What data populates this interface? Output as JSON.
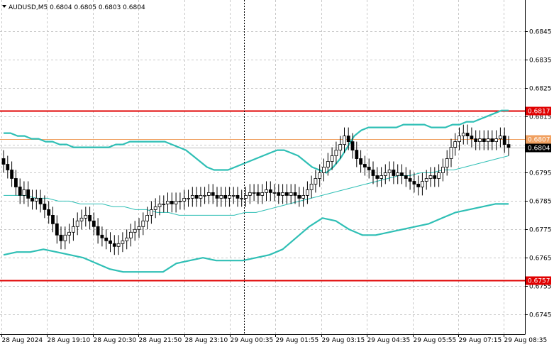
{
  "header": {
    "symbol_info": "AUDUSD,M5 0.6804 0.6805 0.6803 0.6804"
  },
  "colors": {
    "background": "#ffffff",
    "grid": "#c8c8c8",
    "candle": "#000000",
    "bollinger": "#2fbfb5",
    "resistance": "#e00000",
    "support": "#e00000",
    "mid_level": "#f0a060",
    "current_price_bg": "#000000"
  },
  "chart_data": {
    "type": "candlestick",
    "symbol": "AUDUSD",
    "timeframe": "M5",
    "ylim": [
      0.6738,
      0.6856
    ],
    "y_ticks": [
      0.6845,
      0.6835,
      0.6825,
      0.6815,
      0.6805,
      0.6795,
      0.6785,
      0.6775,
      0.6765,
      0.6755,
      0.6745
    ],
    "x_ticks": [
      "28 Aug 2024",
      "28 Aug 19:10",
      "28 Aug 20:30",
      "28 Aug 21:50",
      "28 Aug 23:10",
      "29 Aug 00:35",
      "29 Aug 01:55",
      "29 Aug 03:15",
      "29 Aug 04:35",
      "29 Aug 05:55",
      "29 Aug 07:15",
      "29 Aug 08:35"
    ],
    "grid": true,
    "levels": [
      {
        "name": "resistance",
        "value": 0.6817,
        "label": "0.6817"
      },
      {
        "name": "mid",
        "value": 0.6807,
        "label": "0.6807"
      },
      {
        "name": "support",
        "value": 0.6757,
        "label": "0.6757"
      }
    ],
    "current_price": {
      "value": 0.6804,
      "label": "0.6804"
    },
    "session_separator_index": 50,
    "close": [
      0.6798,
      0.6796,
      0.6793,
      0.679,
      0.6787,
      0.6789,
      0.6786,
      0.6785,
      0.6786,
      0.6784,
      0.6782,
      0.678,
      0.6777,
      0.6773,
      0.6771,
      0.6773,
      0.6774,
      0.6776,
      0.6778,
      0.6779,
      0.678,
      0.6778,
      0.6776,
      0.6773,
      0.6772,
      0.6771,
      0.677,
      0.6769,
      0.677,
      0.6771,
      0.6772,
      0.6774,
      0.6775,
      0.6776,
      0.6778,
      0.678,
      0.6782,
      0.6783,
      0.6784,
      0.6784,
      0.6785,
      0.6784,
      0.6785,
      0.6785,
      0.6786,
      0.6786,
      0.6787,
      0.6786,
      0.6787,
      0.6787,
      0.6788,
      0.6787,
      0.6786,
      0.6787,
      0.6786,
      0.6787,
      0.6787,
      0.6786,
      0.6786,
      0.6787,
      0.6788,
      0.6788,
      0.6787,
      0.6788,
      0.6789,
      0.6788,
      0.6788,
      0.6787,
      0.6788,
      0.6787,
      0.6788,
      0.6787,
      0.6786,
      0.6787,
      0.6789,
      0.6791,
      0.6793,
      0.6795,
      0.6797,
      0.6799,
      0.6801,
      0.6803,
      0.6805,
      0.6808,
      0.6806,
      0.6803,
      0.68,
      0.6798,
      0.6797,
      0.6796,
      0.6794,
      0.6793,
      0.6794,
      0.6795,
      0.6796,
      0.6794,
      0.6795,
      0.6794,
      0.6793,
      0.6792,
      0.6791,
      0.679,
      0.6792,
      0.6793,
      0.6794,
      0.6793,
      0.6795,
      0.6797,
      0.68,
      0.6804,
      0.6806,
      0.6808,
      0.6809,
      0.6808,
      0.6807,
      0.6806,
      0.6807,
      0.6806,
      0.6807,
      0.6806,
      0.6807,
      0.6808,
      0.6805,
      0.6804
    ],
    "upper_band": [
      0.6809,
      0.6809,
      0.6808,
      0.6808,
      0.6807,
      0.6807,
      0.6806,
      0.6806,
      0.6805,
      0.6805,
      0.6804,
      0.6804,
      0.6804,
      0.6804,
      0.6804,
      0.6804,
      0.6805,
      0.6805,
      0.6806,
      0.6806,
      0.6806,
      0.6806,
      0.6806,
      0.6806,
      0.6805,
      0.6804,
      0.6803,
      0.6801,
      0.6799,
      0.6797,
      0.6796,
      0.6796,
      0.6796,
      0.6797,
      0.6798,
      0.6799,
      0.68,
      0.6801,
      0.6802,
      0.6803,
      0.6803,
      0.6802,
      0.6801,
      0.6799,
      0.6797,
      0.6796,
      0.6795,
      0.6797,
      0.68,
      0.6804,
      0.6808,
      0.681,
      0.6811,
      0.6811,
      0.6811,
      0.6811,
      0.6811,
      0.6812,
      0.6812,
      0.6812,
      0.6812,
      0.6811,
      0.6811,
      0.6811,
      0.6812,
      0.6812,
      0.6813,
      0.6813,
      0.6814,
      0.6815,
      0.6816,
      0.6817,
      0.6817
    ],
    "middle_band": [
      0.6787,
      0.6787,
      0.6787,
      0.6786,
      0.6786,
      0.6785,
      0.6785,
      0.6784,
      0.6784,
      0.6784,
      0.6783,
      0.6783,
      0.6782,
      0.6782,
      0.6781,
      0.6781,
      0.678,
      0.678,
      0.678,
      0.678,
      0.678,
      0.678,
      0.6781,
      0.6781,
      0.6782,
      0.6783,
      0.6784,
      0.6785,
      0.6786,
      0.6787,
      0.6788,
      0.6789,
      0.679,
      0.6791,
      0.6792,
      0.6793,
      0.6794,
      0.6794,
      0.6795,
      0.6795,
      0.6796,
      0.6796,
      0.6797,
      0.6798,
      0.6799,
      0.68,
      0.6801
    ],
    "lower_band": [
      0.6766,
      0.6767,
      0.6767,
      0.6768,
      0.6767,
      0.6766,
      0.6765,
      0.6763,
      0.6761,
      0.676,
      0.676,
      0.676,
      0.676,
      0.6763,
      0.6764,
      0.6765,
      0.6764,
      0.6764,
      0.6764,
      0.6765,
      0.6766,
      0.6768,
      0.6772,
      0.6776,
      0.6779,
      0.6778,
      0.6775,
      0.6773,
      0.6773,
      0.6774,
      0.6775,
      0.6776,
      0.6777,
      0.6779,
      0.6781,
      0.6782,
      0.6783,
      0.6784,
      0.6784
    ]
  }
}
